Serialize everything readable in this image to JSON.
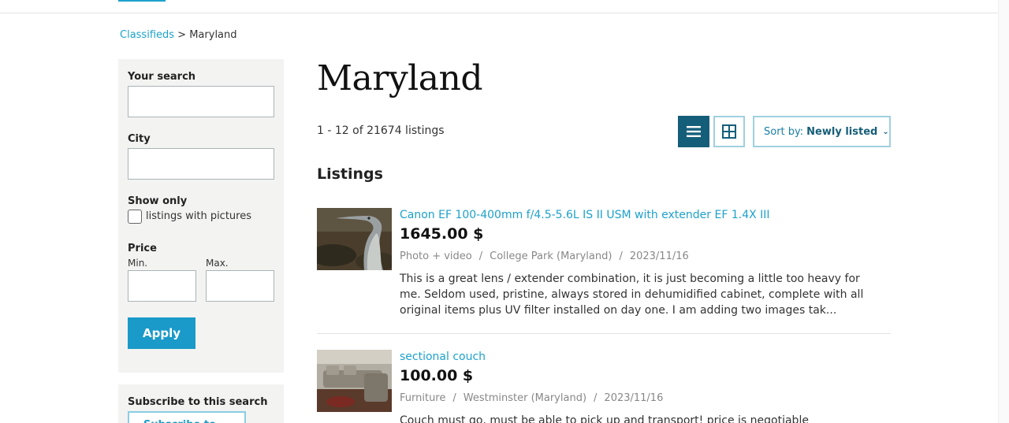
{
  "breadcrumb": {
    "root": "Classifieds",
    "separator": ">",
    "current": "Maryland"
  },
  "filters": {
    "search_label": "Your search",
    "search_value": "",
    "city_label": "City",
    "city_value": "",
    "show_only_label": "Show only",
    "pictures_label": "listings with pictures",
    "pictures_checked": false,
    "price_label": "Price",
    "min_label": "Min.",
    "max_label": "Max.",
    "apply_label": "Apply"
  },
  "subscribe": {
    "label": "Subscribe to this search",
    "button_label": "Subscribe to search"
  },
  "page": {
    "title": "Maryland",
    "count_text": "1 - 12 of 21674 listings",
    "sort_prefix": "Sort by:",
    "sort_value": "Newly listed",
    "section_title": "Listings"
  },
  "colors": {
    "accent": "#1da1cc",
    "dark_teal": "#155e79",
    "sidebar_bg": "#f3f3f2"
  },
  "icons": {
    "list_view": "list-icon",
    "grid_view": "grid-icon",
    "sort_chevron": "chevron-down-icon"
  },
  "listings": [
    {
      "title": "Canon EF 100-400mm f/4.5-5.6L IS II USM with extender EF 1.4X III",
      "price": "1645.00 $",
      "category": "Photo + video",
      "location": "College Park (Maryland)",
      "date": "2023/11/16",
      "description": "This is a great lens / extender combination, it is just becoming a little too heavy for me. Seldom used, pristine, always stored in dehumidified cabinet, complete with all original items plus UV filter installed on day one. I am adding two images tak..."
    },
    {
      "title": "sectional couch",
      "price": "100.00 $",
      "category": "Furniture",
      "location": "Westminster (Maryland)",
      "date": "2023/11/16",
      "description": "Couch must go, must be able to pick up and transport! price is negotiable"
    }
  ]
}
